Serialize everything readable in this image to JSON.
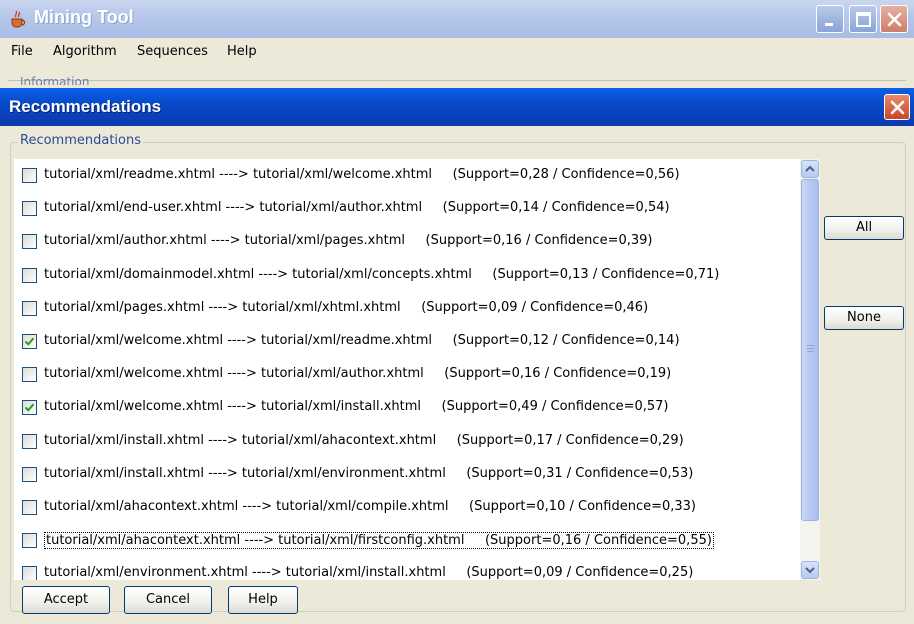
{
  "main_window": {
    "title": "Mining Tool",
    "menu": [
      "File",
      "Algorithm",
      "Sequences",
      "Help"
    ],
    "info_fragment": "Information"
  },
  "dialog": {
    "title": "Recommendations",
    "group_label": "Recommendations",
    "rows": [
      {
        "rule": "tutorial/xml/readme.xhtml ----> tutorial/xml/welcome.xhtml",
        "stats": "(Support=0,28 / Confidence=0,56)",
        "checked": false
      },
      {
        "rule": "tutorial/xml/end-user.xhtml ----> tutorial/xml/author.xhtml",
        "stats": "(Support=0,14 / Confidence=0,54)",
        "checked": false
      },
      {
        "rule": "tutorial/xml/author.xhtml ----> tutorial/xml/pages.xhtml",
        "stats": "(Support=0,16 / Confidence=0,39)",
        "checked": false
      },
      {
        "rule": "tutorial/xml/domainmodel.xhtml ----> tutorial/xml/concepts.xhtml",
        "stats": "(Support=0,13 / Confidence=0,71)",
        "checked": false
      },
      {
        "rule": "tutorial/xml/pages.xhtml ----> tutorial/xml/xhtml.xhtml",
        "stats": "(Support=0,09 / Confidence=0,46)",
        "checked": false
      },
      {
        "rule": "tutorial/xml/welcome.xhtml ----> tutorial/xml/readme.xhtml",
        "stats": "(Support=0,12 / Confidence=0,14)",
        "checked": true
      },
      {
        "rule": "tutorial/xml/welcome.xhtml ----> tutorial/xml/author.xhtml",
        "stats": "(Support=0,16 / Confidence=0,19)",
        "checked": false
      },
      {
        "rule": "tutorial/xml/welcome.xhtml ----> tutorial/xml/install.xhtml",
        "stats": "(Support=0,49 / Confidence=0,57)",
        "checked": true
      },
      {
        "rule": "tutorial/xml/install.xhtml ----> tutorial/xml/ahacontext.xhtml",
        "stats": "(Support=0,17 / Confidence=0,29)",
        "checked": false
      },
      {
        "rule": "tutorial/xml/install.xhtml ----> tutorial/xml/environment.xhtml",
        "stats": "(Support=0,31 / Confidence=0,53)",
        "checked": false
      },
      {
        "rule": "tutorial/xml/ahacontext.xhtml ----> tutorial/xml/compile.xhtml",
        "stats": "(Support=0,10 / Confidence=0,33)",
        "checked": false
      },
      {
        "rule": "tutorial/xml/ahacontext.xhtml ----> tutorial/xml/firstconfig.xhtml",
        "stats": "(Support=0,16 / Confidence=0,55)",
        "checked": false,
        "focused": true
      },
      {
        "rule": "tutorial/xml/environment.xhtml ----> tutorial/xml/install.xhtml",
        "stats": "(Support=0,09 / Confidence=0,25)",
        "checked": false
      }
    ],
    "side_buttons": {
      "all": "All",
      "none": "None"
    },
    "bottom_buttons": {
      "accept": "Accept",
      "cancel": "Cancel",
      "help": "Help"
    }
  },
  "icons": {
    "app": "java-cup-icon",
    "minimize": "minimize-icon",
    "maximize": "maximize-icon",
    "close": "close-icon",
    "check": "check-icon",
    "scroll_up": "chevron-up-icon",
    "scroll_down": "chevron-down-icon"
  },
  "colors": {
    "dialog_titlebar": "#0848c8",
    "inactive_titlebar": "#b7c8ea",
    "face": "#ece9d8",
    "check": "#21a121"
  }
}
